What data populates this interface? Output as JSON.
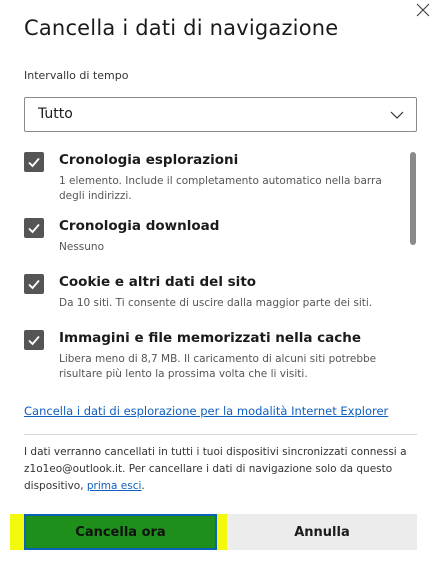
{
  "dialog": {
    "title": "Cancella i dati di navigazione",
    "time_range_label": "Intervallo di tempo",
    "time_range_value": "Tutto"
  },
  "items": [
    {
      "title": "Cronologia esplorazioni",
      "description": "1 elemento. Include il completamento automatico nella barra degli indirizzi.",
      "checked": true
    },
    {
      "title": "Cronologia download",
      "description": "Nessuno",
      "checked": true
    },
    {
      "title": "Cookie e altri dati del sito",
      "description": "Da 10 siti. Ti consente di uscire dalla maggior parte dei siti.",
      "checked": true
    },
    {
      "title": "Immagini e file memorizzati nella cache",
      "description": "Libera meno di 8,7 MB. Il caricamento di alcuni siti potrebbe risultare più lento la prossima volta che li visiti.",
      "checked": true
    }
  ],
  "ie_link": "Cancella i dati di esplorazione per la modalità Internet Explorer",
  "sync": {
    "text": "I dati verranno cancellati in tutti i tuoi dispositivi sincronizzati connessi a z1o1eo@outlook.it. Per cancellare i dati di navigazione solo da questo dispositivo, ",
    "link": "prima esci",
    "suffix": "."
  },
  "buttons": {
    "primary": "Cancella ora",
    "secondary": "Annulla"
  },
  "colors": {
    "primary_button": "#1d8f1a",
    "primary_button_border": "#0b63b8",
    "highlight": "#f3f90a",
    "link": "#0f5fbf",
    "checkbox": "#555555"
  },
  "icons": {
    "close": "close-icon",
    "dropdown": "chevron-down-icon",
    "check": "checkmark-icon"
  }
}
